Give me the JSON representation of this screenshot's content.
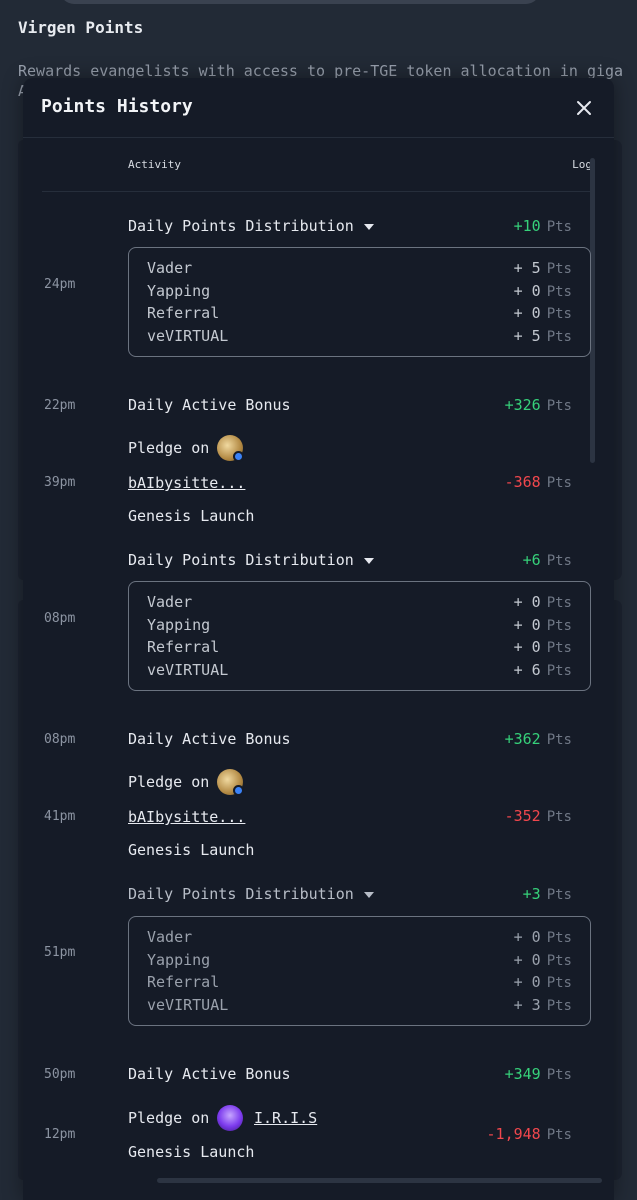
{
  "background": {
    "title": "Virgen Points",
    "description": "Rewards evangelists with access to pre-TGE token allocation in giga",
    "description_line2": "A"
  },
  "modal": {
    "title": "Points History",
    "columns": {
      "activity": "Activity",
      "log": "Log"
    },
    "unit": "Pts"
  },
  "entries": [
    {
      "time": "24pm",
      "activity": "Daily Points Distribution",
      "points": "+10",
      "breakdown": [
        {
          "label": "Vader",
          "value": "+ 5"
        },
        {
          "label": "Yapping",
          "value": "+ 0"
        },
        {
          "label": "Referral",
          "value": "+ 0"
        },
        {
          "label": "veVIRTUAL",
          "value": "+ 5"
        }
      ]
    },
    {
      "time": "22pm",
      "activity": "Daily Active Bonus",
      "points": "+326"
    },
    {
      "time": "39pm",
      "pledge": "Pledge on",
      "agent": "bAIbysitte...",
      "launch": "Genesis Launch",
      "points": "-368"
    },
    {
      "time": "08pm",
      "activity": "Daily Points Distribution",
      "points": "+6",
      "breakdown": [
        {
          "label": "Vader",
          "value": "+ 0"
        },
        {
          "label": "Yapping",
          "value": "+ 0"
        },
        {
          "label": "Referral",
          "value": "+ 0"
        },
        {
          "label": "veVIRTUAL",
          "value": "+ 6"
        }
      ]
    },
    {
      "time": "08pm",
      "activity": "Daily Active Bonus",
      "points": "+362"
    },
    {
      "time": "41pm",
      "pledge": "Pledge on",
      "agent": "bAIbysitte...",
      "launch": "Genesis Launch",
      "points": "-352"
    },
    {
      "time": "51pm",
      "activity": "Daily Points Distribution",
      "points": "+3",
      "breakdown": [
        {
          "label": "Vader",
          "value": "+ 0"
        },
        {
          "label": "Yapping",
          "value": "+ 0"
        },
        {
          "label": "Referral",
          "value": "+ 0"
        },
        {
          "label": "veVIRTUAL",
          "value": "+ 3"
        }
      ]
    },
    {
      "time": "50pm",
      "activity": "Daily Active Bonus",
      "points": "+349"
    },
    {
      "time": "12pm",
      "pledge": "Pledge on",
      "agent": "I.R.I.S",
      "launch": "Genesis Launch",
      "points": "-1,948"
    }
  ],
  "colors": {
    "positive": "#36d17a",
    "negative": "#f0474d",
    "accent_verified": "#3b82f6"
  }
}
